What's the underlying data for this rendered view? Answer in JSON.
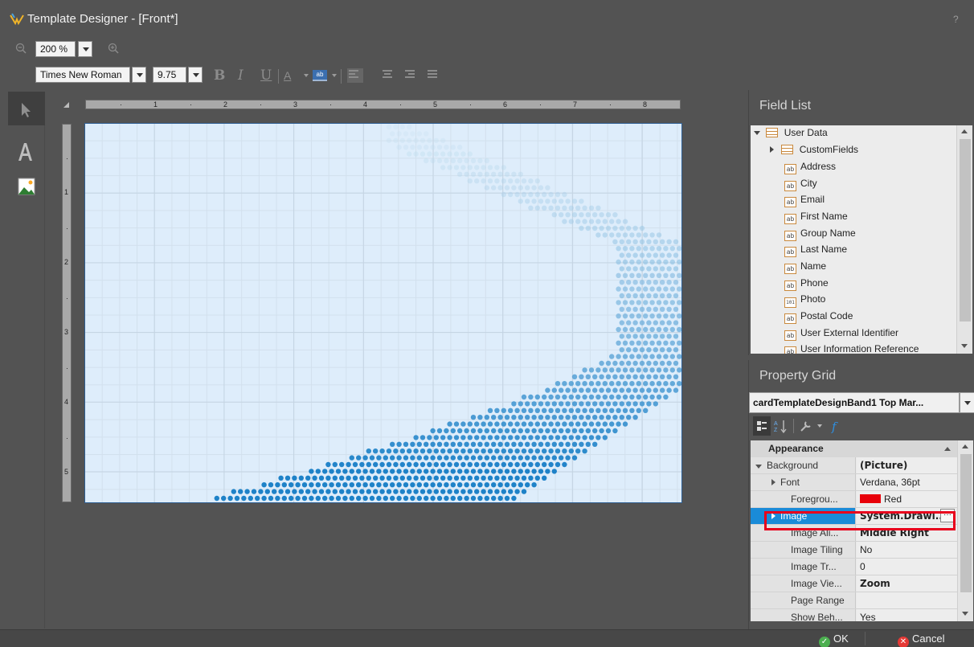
{
  "window": {
    "title": "Template Designer - [Front*]",
    "help": "?"
  },
  "zoom": {
    "value": "200 %"
  },
  "format": {
    "font_family": "Times New Roman",
    "font_size": "9.75",
    "bold": "B",
    "italic": "I",
    "underline": "U",
    "font_color": "A",
    "highlight": "ab"
  },
  "ruler": {
    "horizontal_labels": [
      "1",
      "2",
      "3",
      "4",
      "5",
      "6",
      "7",
      "8"
    ],
    "vertical_labels": [
      "1",
      "2",
      "3",
      "4",
      "5"
    ]
  },
  "field_list": {
    "title": "Field List",
    "items": [
      {
        "label": "User Data",
        "type": "table"
      },
      {
        "label": "CustomFields",
        "type": "table"
      },
      {
        "label": "Address",
        "type": "ab"
      },
      {
        "label": "City",
        "type": "ab"
      },
      {
        "label": "Email",
        "type": "ab"
      },
      {
        "label": "First Name",
        "type": "ab"
      },
      {
        "label": "Group Name",
        "type": "ab"
      },
      {
        "label": "Last Name",
        "type": "ab"
      },
      {
        "label": "Name",
        "type": "ab"
      },
      {
        "label": "Phone",
        "type": "ab"
      },
      {
        "label": "Photo",
        "type": "101"
      },
      {
        "label": "Postal Code",
        "type": "ab"
      },
      {
        "label": "User External Identifier",
        "type": "ab"
      },
      {
        "label": "User Information Reference",
        "type": "ab"
      }
    ]
  },
  "property_grid": {
    "title": "Property Grid",
    "selected_object": "cardTemplateDesignBand1  Top Mar...",
    "category": "Appearance",
    "rows": [
      {
        "name": "Background",
        "value": "(Picture)"
      },
      {
        "name": "Font",
        "value": "Verdana, 36pt"
      },
      {
        "name": "Foregrou...",
        "value": "Red"
      },
      {
        "name": "Image",
        "value": "System.Drawi..."
      },
      {
        "name": "Image Ali...",
        "value": "Middle Right"
      },
      {
        "name": "Image Tiling",
        "value": "No"
      },
      {
        "name": "Image Tr...",
        "value": "0"
      },
      {
        "name": "Image Vie...",
        "value": "Zoom"
      },
      {
        "name": "Page Range",
        "value": ""
      },
      {
        "name": "Show Beh...",
        "value": "Yes"
      }
    ],
    "foreground_color": "#e8000a",
    "ellipsis": "···"
  },
  "footer": {
    "ok": "OK",
    "cancel": "Cancel"
  },
  "colors": {
    "canvas": "#deedfb",
    "selection": "#1a8bd8",
    "highlight_border": "#e8001c",
    "ok_icon": "#4caf50",
    "cancel_icon": "#e53935"
  }
}
